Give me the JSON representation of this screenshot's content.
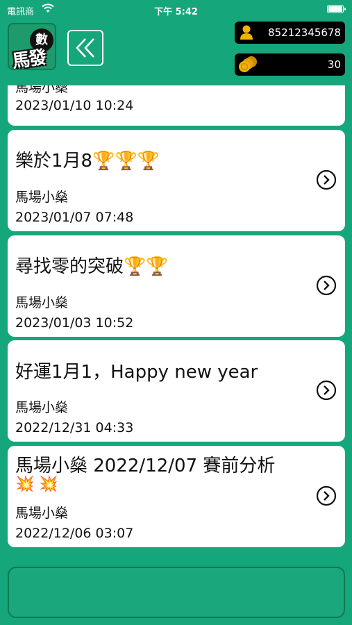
{
  "status_bar": {
    "carrier": "電訊商",
    "time": "下午 5:42"
  },
  "header": {
    "logo_badge": "數",
    "logo_text": "馬發",
    "account_number": "85212345678",
    "coins": "30"
  },
  "posts": [
    {
      "title": "",
      "author": "馬場小燊",
      "date": "2023/01/10 10:24"
    },
    {
      "title": "樂於1月8🏆🏆🏆",
      "author": "馬場小燊",
      "date": "2023/01/07 07:48"
    },
    {
      "title": "尋找零的突破🏆🏆",
      "author": "馬場小燊",
      "date": "2023/01/03 10:52"
    },
    {
      "title": "好運1月1，Happy new year",
      "author": "馬場小燊",
      "date": "2022/12/31 04:33"
    },
    {
      "title": "馬場小燊 2022/12/07 賽前分析",
      "title_line2": "💥 💥",
      "author": "馬場小燊",
      "date": "2022/12/06 03:07"
    }
  ],
  "colors": {
    "background": "#16a67b",
    "card": "#ffffff",
    "pill": "#000000",
    "accent_yellow": "#f0b400"
  }
}
